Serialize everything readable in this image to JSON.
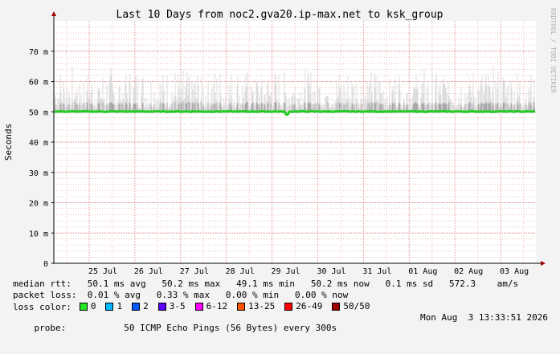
{
  "chart_data": {
    "type": "line",
    "title": "Last 10 Days from noc2.gva20.ip-max.net to ksk_group",
    "ylabel": "Seconds",
    "watermark": "RRDTOOL / TOBI OETIKER",
    "ylim": [
      0,
      0.08
    ],
    "y_ticks": [
      {
        "value": 0,
        "label": "0"
      },
      {
        "value": 0.01,
        "label": "10 m"
      },
      {
        "value": 0.02,
        "label": "20 m"
      },
      {
        "value": 0.03,
        "label": "30 m"
      },
      {
        "value": 0.04,
        "label": "40 m"
      },
      {
        "value": 0.05,
        "label": "50 m"
      },
      {
        "value": 0.06,
        "label": "60 m"
      },
      {
        "value": 0.07,
        "label": "70 m"
      }
    ],
    "x_ticks": [
      "25 Jul",
      "26 Jul",
      "27 Jul",
      "28 Jul",
      "29 Jul",
      "30 Jul",
      "31 Jul",
      "01 Aug",
      "02 Aug",
      "03 Aug"
    ],
    "grid": true,
    "series": [
      {
        "name": "median rtt",
        "color": "#22cc22",
        "baseline": 0.0501,
        "dip_at": "29 Jul",
        "dip_value": 0.0491
      },
      {
        "name": "rtt spread",
        "color": "#c8c8c8",
        "max": 0.0652
      }
    ]
  },
  "stats": {
    "median_rtt": "median rtt:   50.1 ms avg   50.2 ms max   49.1 ms min   50.2 ms now   0.1 ms sd   572.3    am/s",
    "packet_loss": "packet loss:  0.01 % avg   0.33 % max   0.00 % min   0.00 % now",
    "loss_label": "loss color:"
  },
  "loss_colors": [
    {
      "label": "0",
      "color": "#26e626"
    },
    {
      "label": "1",
      "color": "#00b8ff"
    },
    {
      "label": "2",
      "color": "#0059ff"
    },
    {
      "label": "3-5",
      "color": "#5e00ff"
    },
    {
      "label": "6-12",
      "color": "#ff00ff"
    },
    {
      "label": "13-25",
      "color": "#ff5500"
    },
    {
      "label": "26-49",
      "color": "#ff0000"
    },
    {
      "label": "50/50",
      "color": "#a10000"
    }
  ],
  "probe": {
    "label": "probe:",
    "desc": "50 ICMP Echo Pings (56 Bytes) every 300s",
    "timestamp": "Mon Aug  3 13:33:51 2026"
  },
  "colors": {
    "background": "#f3f3f3",
    "plot": "#ffffff",
    "grid_minor": "#f2bcbc",
    "grid_major": "#e39a9a"
  }
}
